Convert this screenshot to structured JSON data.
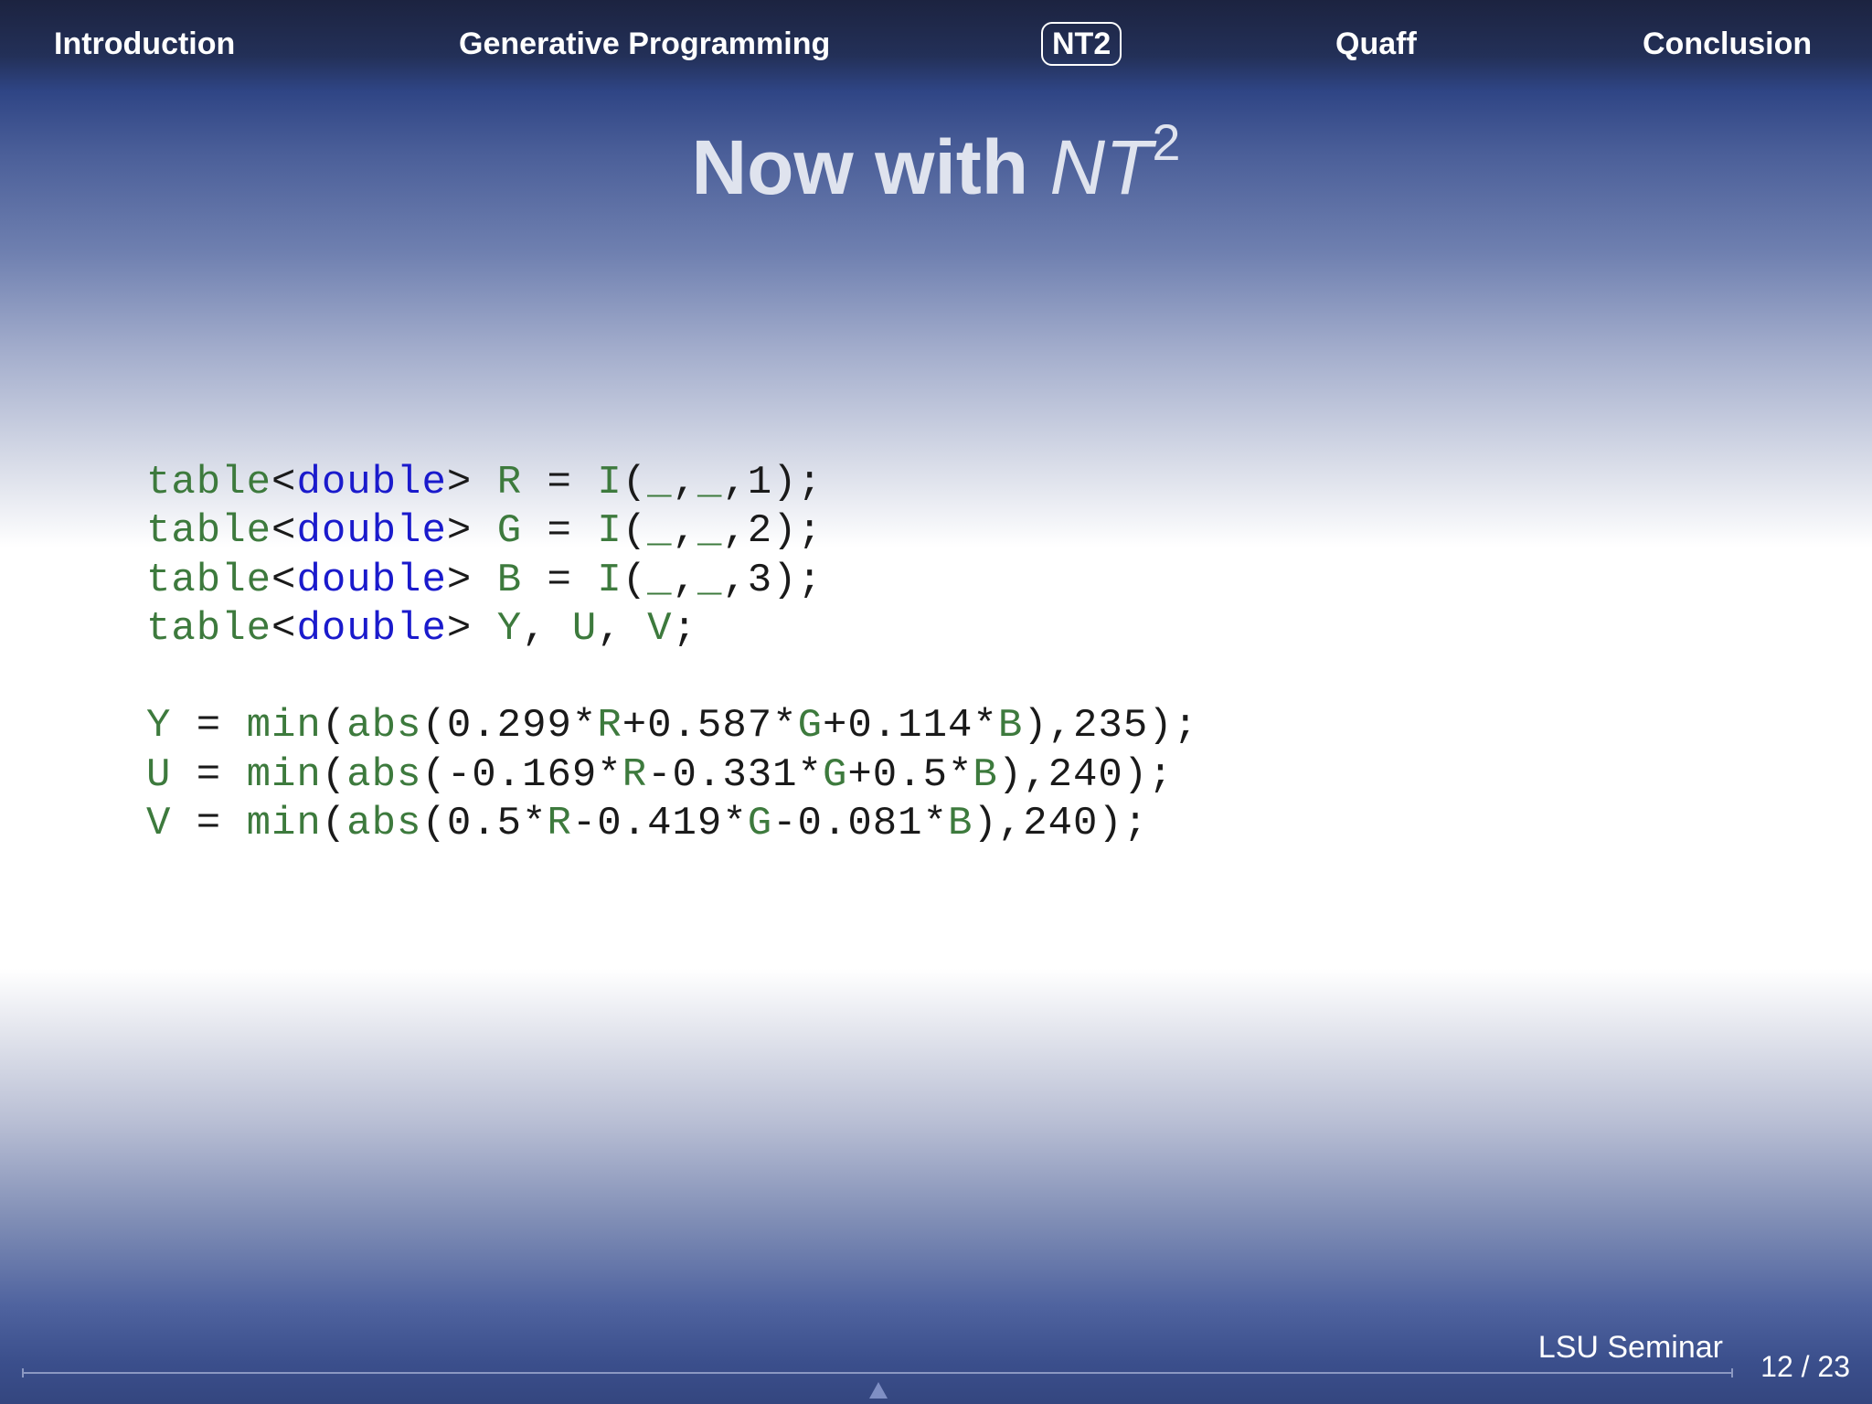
{
  "navbar": {
    "items": [
      {
        "label": "Introduction"
      },
      {
        "label": "Generative Programming"
      },
      {
        "label": "NT2"
      },
      {
        "label": "Quaff"
      },
      {
        "label": "Conclusion"
      }
    ],
    "active_index": 2
  },
  "title": {
    "prefix": "Now with ",
    "math": "NT",
    "superscript": "2"
  },
  "code": {
    "lines": [
      [
        {
          "t": "table",
          "c": "kw"
        },
        {
          "t": "<",
          "c": "pl"
        },
        {
          "t": "double",
          "c": "ty"
        },
        {
          "t": "> ",
          "c": "pl"
        },
        {
          "t": "R",
          "c": "id"
        },
        {
          "t": " = ",
          "c": "pl"
        },
        {
          "t": "I",
          "c": "id"
        },
        {
          "t": "(",
          "c": "pl"
        },
        {
          "t": "_",
          "c": "id"
        },
        {
          "t": ",",
          "c": "pl"
        },
        {
          "t": "_",
          "c": "id"
        },
        {
          "t": ",1);",
          "c": "pl"
        }
      ],
      [
        {
          "t": "table",
          "c": "kw"
        },
        {
          "t": "<",
          "c": "pl"
        },
        {
          "t": "double",
          "c": "ty"
        },
        {
          "t": "> ",
          "c": "pl"
        },
        {
          "t": "G",
          "c": "id"
        },
        {
          "t": " = ",
          "c": "pl"
        },
        {
          "t": "I",
          "c": "id"
        },
        {
          "t": "(",
          "c": "pl"
        },
        {
          "t": "_",
          "c": "id"
        },
        {
          "t": ",",
          "c": "pl"
        },
        {
          "t": "_",
          "c": "id"
        },
        {
          "t": ",2);",
          "c": "pl"
        }
      ],
      [
        {
          "t": "table",
          "c": "kw"
        },
        {
          "t": "<",
          "c": "pl"
        },
        {
          "t": "double",
          "c": "ty"
        },
        {
          "t": "> ",
          "c": "pl"
        },
        {
          "t": "B",
          "c": "id"
        },
        {
          "t": " = ",
          "c": "pl"
        },
        {
          "t": "I",
          "c": "id"
        },
        {
          "t": "(",
          "c": "pl"
        },
        {
          "t": "_",
          "c": "id"
        },
        {
          "t": ",",
          "c": "pl"
        },
        {
          "t": "_",
          "c": "id"
        },
        {
          "t": ",3);",
          "c": "pl"
        }
      ],
      [
        {
          "t": "table",
          "c": "kw"
        },
        {
          "t": "<",
          "c": "pl"
        },
        {
          "t": "double",
          "c": "ty"
        },
        {
          "t": "> ",
          "c": "pl"
        },
        {
          "t": "Y",
          "c": "id"
        },
        {
          "t": ", ",
          "c": "pl"
        },
        {
          "t": "U",
          "c": "id"
        },
        {
          "t": ", ",
          "c": "pl"
        },
        {
          "t": "V",
          "c": "id"
        },
        {
          "t": ";",
          "c": "pl"
        }
      ],
      [],
      [
        {
          "t": "Y",
          "c": "id"
        },
        {
          "t": " = ",
          "c": "pl"
        },
        {
          "t": "min",
          "c": "id"
        },
        {
          "t": "(",
          "c": "pl"
        },
        {
          "t": "abs",
          "c": "id"
        },
        {
          "t": "(0.299*",
          "c": "pl"
        },
        {
          "t": "R",
          "c": "id"
        },
        {
          "t": "+0.587*",
          "c": "pl"
        },
        {
          "t": "G",
          "c": "id"
        },
        {
          "t": "+0.114*",
          "c": "pl"
        },
        {
          "t": "B",
          "c": "id"
        },
        {
          "t": "),235);",
          "c": "pl"
        }
      ],
      [
        {
          "t": "U",
          "c": "id"
        },
        {
          "t": " = ",
          "c": "pl"
        },
        {
          "t": "min",
          "c": "id"
        },
        {
          "t": "(",
          "c": "pl"
        },
        {
          "t": "abs",
          "c": "id"
        },
        {
          "t": "(-0.169*",
          "c": "pl"
        },
        {
          "t": "R",
          "c": "id"
        },
        {
          "t": "-0.331*",
          "c": "pl"
        },
        {
          "t": "G",
          "c": "id"
        },
        {
          "t": "+0.5*",
          "c": "pl"
        },
        {
          "t": "B",
          "c": "id"
        },
        {
          "t": "),240);",
          "c": "pl"
        }
      ],
      [
        {
          "t": "V",
          "c": "id"
        },
        {
          "t": " = ",
          "c": "pl"
        },
        {
          "t": "min",
          "c": "id"
        },
        {
          "t": "(",
          "c": "pl"
        },
        {
          "t": "abs",
          "c": "id"
        },
        {
          "t": "(0.5*",
          "c": "pl"
        },
        {
          "t": "R",
          "c": "id"
        },
        {
          "t": "-0.419*",
          "c": "pl"
        },
        {
          "t": "G",
          "c": "id"
        },
        {
          "t": "-0.081*",
          "c": "pl"
        },
        {
          "t": "B",
          "c": "id"
        },
        {
          "t": "),240);",
          "c": "pl"
        }
      ]
    ]
  },
  "footer": {
    "title": "LSU Seminar",
    "page": "12 / 23"
  },
  "colors": {
    "keyword": "#3d7a3d",
    "type": "#1a1acc",
    "identifier": "#3d7a3d",
    "plain": "#1a1a1a",
    "nav_text": "#ffffff",
    "title_text": "#dfe3ee"
  },
  "icons": {
    "navigation": "up-triangle-icon"
  }
}
